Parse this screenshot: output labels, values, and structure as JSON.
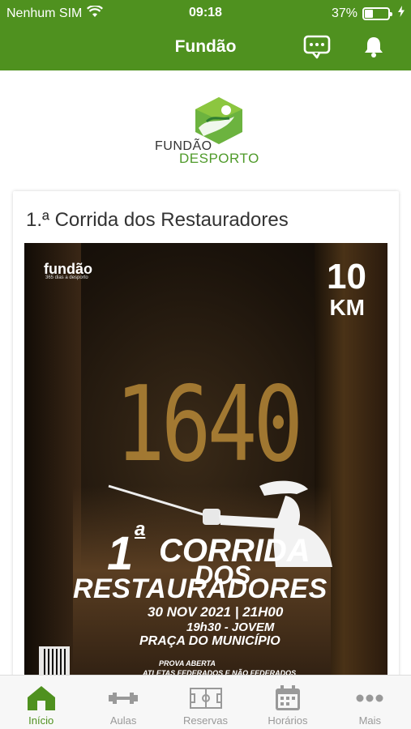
{
  "status_bar": {
    "carrier": "Nenhum SIM",
    "time": "09:18",
    "battery_percent": "37%",
    "battery_level": 0.37
  },
  "nav": {
    "title": "Fundão",
    "icons": [
      "chat-icon",
      "bell-icon"
    ]
  },
  "logo": {
    "line1": "FUNDÃO",
    "line2": "DESPORTO"
  },
  "post": {
    "title": "1.ª Corrida dos Restauradores",
    "poster": {
      "brand": "fundão",
      "brand_sub": "365 dias a desporto",
      "distance_number": "10",
      "distance_unit": "KM",
      "year": "1640",
      "title_ordinal": "1",
      "title_ordinal_suffix": "a",
      "title_line1": "CORRIDA",
      "title_line2": "DOS",
      "title_line3": "RESTAURADORES",
      "date_time": "30 NOV 2021 | 21H00",
      "youth_time": "19h30 - JOVEM",
      "location": "PRAÇA DO MUNICÍPIO",
      "open_race": "PROVA ABERTA",
      "athletes": "ATLETAS FEDERADOS E NÃO FEDERADOS"
    }
  },
  "tabs": [
    {
      "label": "Início",
      "icon": "home-icon",
      "active": true
    },
    {
      "label": "Aulas",
      "icon": "dumbbell-icon",
      "active": false
    },
    {
      "label": "Reservas",
      "icon": "field-icon",
      "active": false
    },
    {
      "label": "Horários",
      "icon": "calendar-icon",
      "active": false
    },
    {
      "label": "Mais",
      "icon": "more-icon",
      "active": false
    }
  ],
  "colors": {
    "brand_green": "#4f911f",
    "inactive_tab": "#999999"
  }
}
